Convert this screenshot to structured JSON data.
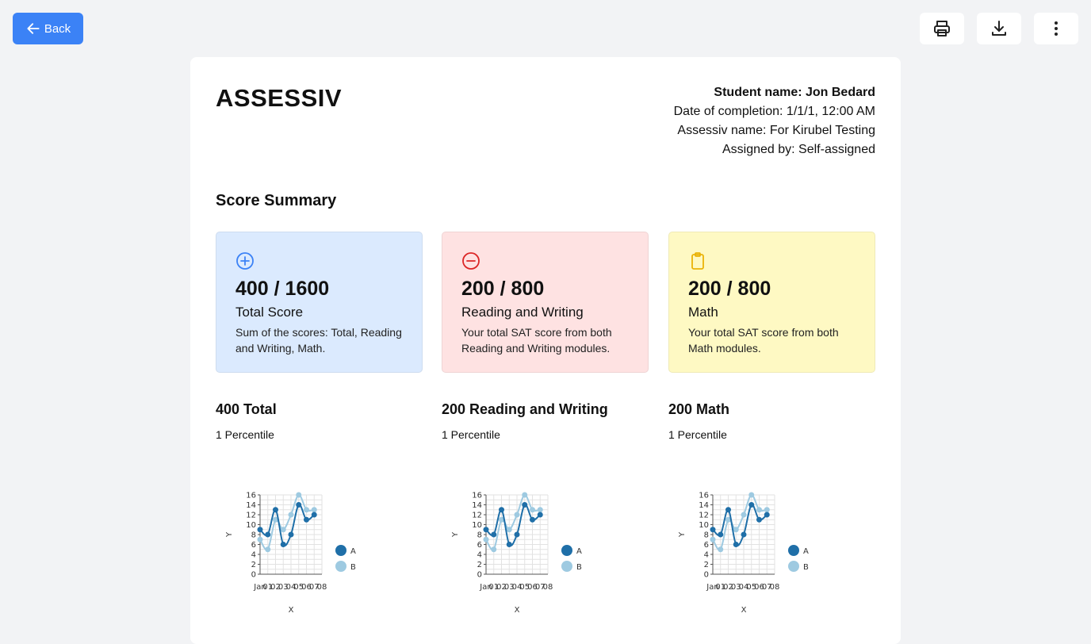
{
  "toolbar": {
    "back_label": "Back",
    "icons": [
      "arrow-left-icon",
      "printer-icon",
      "download-icon",
      "more-vertical-icon"
    ]
  },
  "report": {
    "brand": "ASSESSIV",
    "student_name": "Student name: Jon Bedard",
    "date_of_completion": "Date of completion: 1/1/1, 12:00 AM",
    "assessiv_name": "Assessiv name: For Kirubel Testing",
    "assigned_by": "Assigned by: Self-assigned"
  },
  "summary": {
    "title": "Score Summary",
    "cards": [
      {
        "score": "400 / 1600",
        "label": "Total Score",
        "desc": "Sum of the scores: Total, Reading and Writing, Math.",
        "icon": "plus-circle-icon",
        "color": "#dbeafe",
        "icon_color": "#3b82f6"
      },
      {
        "score": "200 / 800",
        "label": "Reading and Writing",
        "desc": "Your total SAT score from both Reading and Writing modules.",
        "icon": "minus-circle-icon",
        "color": "#fee2e2",
        "icon_color": "#dc2626"
      },
      {
        "score": "200 / 800",
        "label": "Math",
        "desc": "Your total SAT score from both Math modules.",
        "icon": "clipboard-icon",
        "color": "#fef9c3",
        "icon_color": "#eab308"
      }
    ]
  },
  "details": [
    {
      "title": "400 Total",
      "percentile": "1 Percentile"
    },
    {
      "title": "200 Reading and Writing",
      "percentile": "1 Percentile"
    },
    {
      "title": "200 Math",
      "percentile": "1 Percentile"
    }
  ],
  "chart_data": [
    {
      "type": "line",
      "x": [
        "Jan",
        "01",
        "02",
        "03",
        "04",
        "05",
        "06",
        "07",
        "08"
      ],
      "series": [
        {
          "name": "A",
          "values": [
            9,
            8,
            13,
            6,
            8,
            14,
            11,
            12
          ],
          "color": "#1f6fa8"
        },
        {
          "name": "B",
          "values": [
            7,
            5,
            11,
            9,
            12,
            16,
            13,
            13
          ],
          "color": "#9ecae1"
        }
      ],
      "xlabel": "X",
      "ylabel": "Y",
      "ylim": [
        0,
        16
      ],
      "yticks": [
        0,
        2,
        4,
        6,
        8,
        10,
        12,
        14,
        16
      ],
      "grid": true,
      "legend": "right"
    },
    {
      "type": "line",
      "x": [
        "Jan",
        "01",
        "02",
        "03",
        "04",
        "05",
        "06",
        "07",
        "08"
      ],
      "series": [
        {
          "name": "A",
          "values": [
            9,
            8,
            13,
            6,
            8,
            14,
            11,
            12
          ],
          "color": "#1f6fa8"
        },
        {
          "name": "B",
          "values": [
            7,
            5,
            11,
            9,
            12,
            16,
            13,
            13
          ],
          "color": "#9ecae1"
        }
      ],
      "xlabel": "X",
      "ylabel": "Y",
      "ylim": [
        0,
        16
      ],
      "yticks": [
        0,
        2,
        4,
        6,
        8,
        10,
        12,
        14,
        16
      ],
      "grid": true,
      "legend": "right"
    },
    {
      "type": "line",
      "x": [
        "Jan",
        "01",
        "02",
        "03",
        "04",
        "05",
        "06",
        "07",
        "08"
      ],
      "series": [
        {
          "name": "A",
          "values": [
            9,
            8,
            13,
            6,
            8,
            14,
            11,
            12
          ],
          "color": "#1f6fa8"
        },
        {
          "name": "B",
          "values": [
            7,
            5,
            11,
            9,
            12,
            16,
            13,
            13
          ],
          "color": "#9ecae1"
        }
      ],
      "xlabel": "X",
      "ylabel": "Y",
      "ylim": [
        0,
        16
      ],
      "yticks": [
        0,
        2,
        4,
        6,
        8,
        10,
        12,
        14,
        16
      ],
      "grid": true,
      "legend": "right"
    }
  ]
}
